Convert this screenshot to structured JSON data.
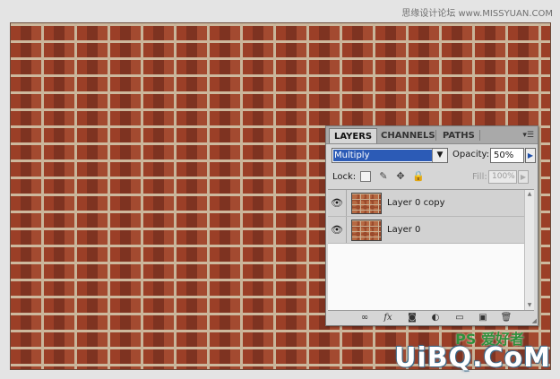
{
  "watermark_top": "思缘设计论坛 www.MISSYUAN.COM",
  "watermark_logo": "UiBQ.CoM",
  "watermark_logo_ps": "PS 爱好者",
  "panel": {
    "tabs": [
      {
        "label": "LAYERS",
        "active": true
      },
      {
        "label": "CHANNELS",
        "active": false
      },
      {
        "label": "PATHS",
        "active": false
      }
    ],
    "blend_mode": "Multiply",
    "opacity_label": "Opacity:",
    "opacity_value": "50%",
    "lock_label": "Lock:",
    "fill_label": "Fill:",
    "fill_value": "100%",
    "layers": [
      {
        "name": "Layer 0 copy",
        "visible": true
      },
      {
        "name": "Layer 0",
        "visible": true
      }
    ],
    "bottom_icons": [
      "link-layers-icon",
      "fx-icon",
      "add-mask-icon",
      "adjustment-layer-icon",
      "new-group-icon",
      "new-layer-icon",
      "delete-layer-icon"
    ]
  }
}
